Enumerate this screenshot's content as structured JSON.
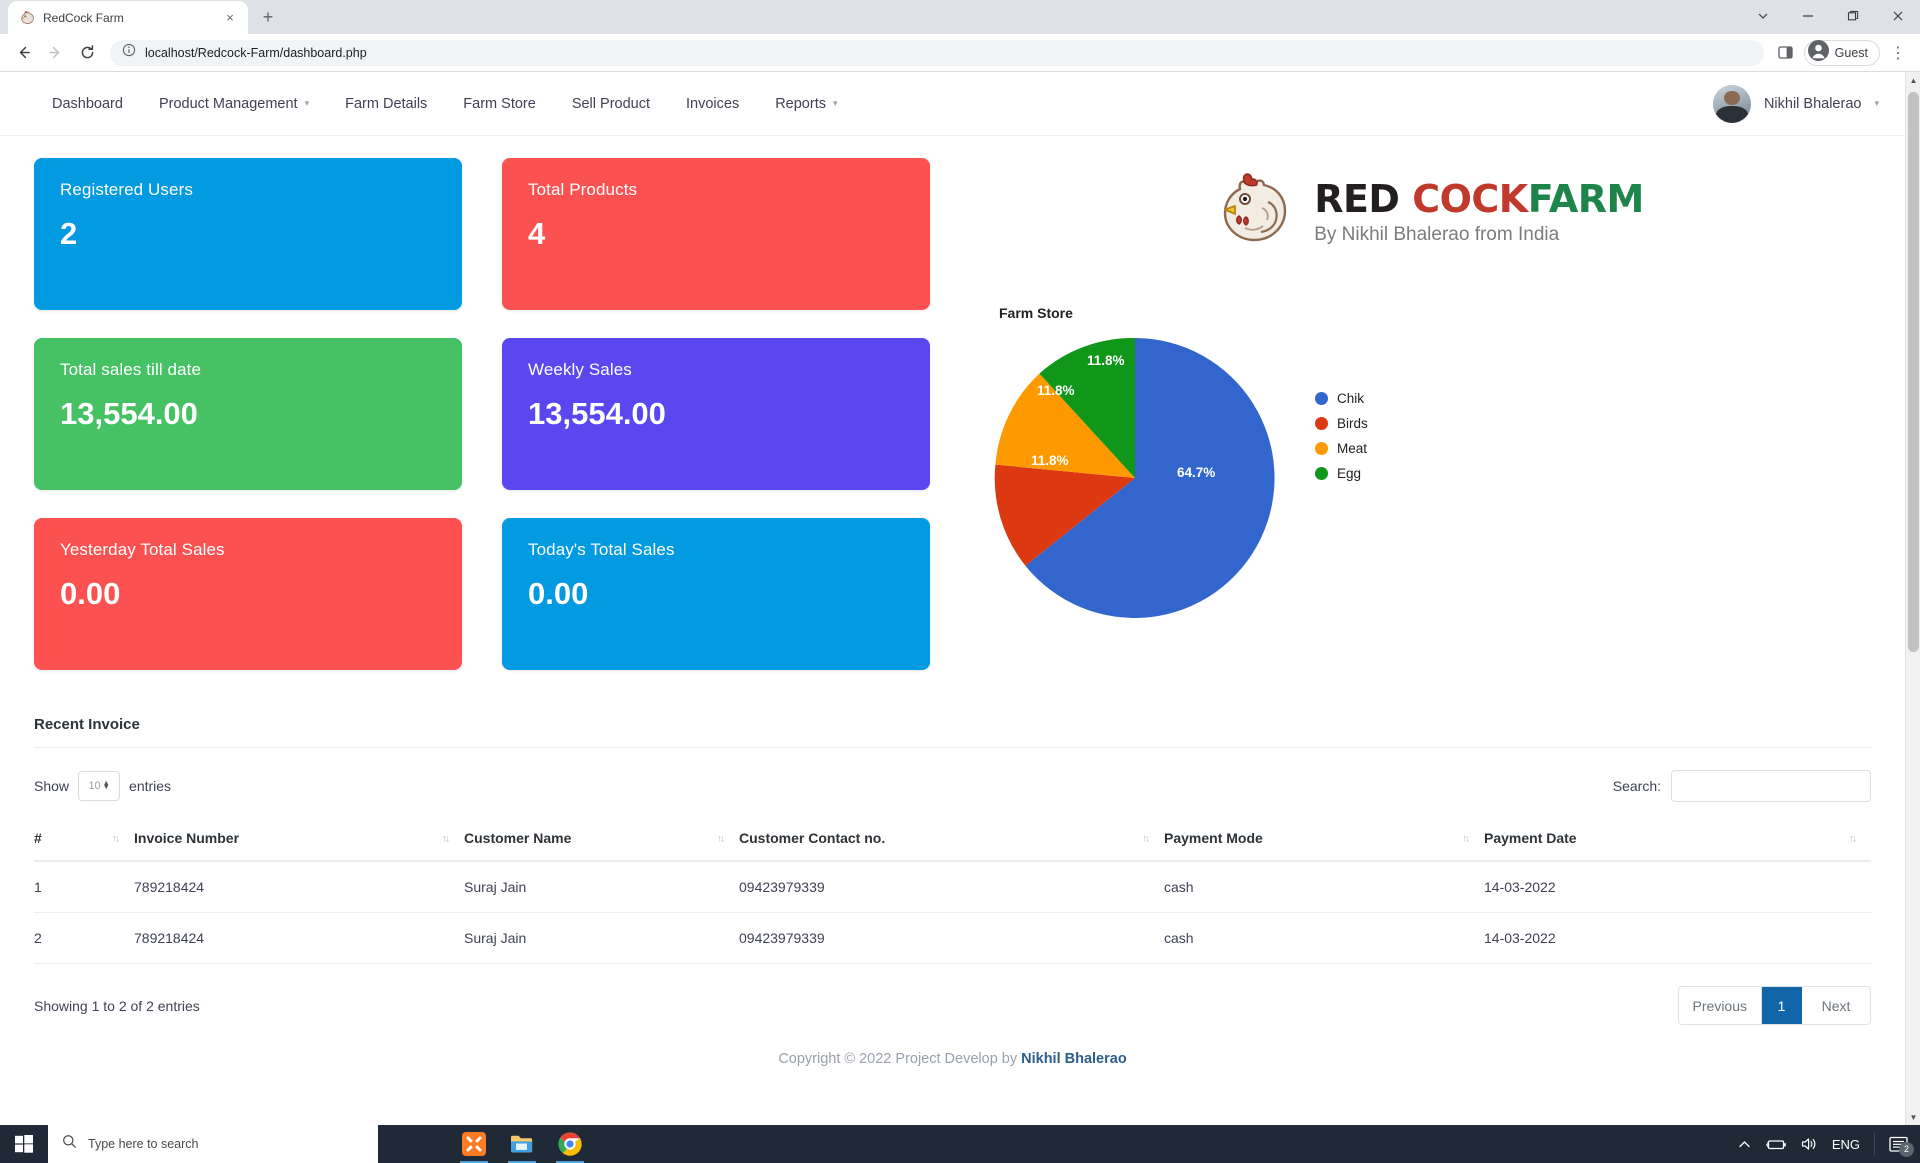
{
  "browser": {
    "tab_title": "RedCock Farm",
    "tab_favicon_name": "rooster-favicon",
    "new_tab_label": "+",
    "close_tab_label": "×",
    "window_controls": {
      "minimize": "—",
      "maximize": "❐",
      "close": "✕",
      "tab_search": "⌄"
    },
    "url": "localhost/Redcock-Farm/dashboard.php",
    "url_prefix": "localhost",
    "profile_label": "Guest",
    "back_label": "←",
    "forward_label": "→",
    "reload_label": "↻",
    "menu_label": "⋮"
  },
  "navbar": {
    "links": [
      {
        "label": "Dashboard",
        "caret": false
      },
      {
        "label": "Product Management",
        "caret": true
      },
      {
        "label": "Farm Details",
        "caret": false
      },
      {
        "label": "Farm Store",
        "caret": false
      },
      {
        "label": "Sell Product",
        "caret": false
      },
      {
        "label": "Invoices",
        "caret": false
      },
      {
        "label": "Reports",
        "caret": true
      }
    ],
    "username": "Nikhil Bhalerao",
    "user_caret": "⌄"
  },
  "stats": [
    {
      "title": "Registered Users",
      "value": "2",
      "color": "#029ae0"
    },
    {
      "title": "Total Products",
      "value": "4",
      "color": "#fb5151"
    },
    {
      "title": "Total sales till date",
      "value": "13,554.00",
      "color": "#46c163"
    },
    {
      "title": "Weekly Sales",
      "value": "13,554.00",
      "color": "#5b47f0"
    },
    {
      "title": "Yesterday Total Sales",
      "value": "0.00",
      "color": "#fb5151"
    },
    {
      "title": "Today's Total Sales",
      "value": "0.00",
      "color": "#029ae0"
    }
  ],
  "logo": {
    "word1": "RED",
    "word2": "COCK",
    "word3": "FARM",
    "tagline": "By Nikhil Bhalerao from India",
    "icon_name": "rooster-logo-icon",
    "color1": "#231f20",
    "color2": "#c0392b",
    "color3": "#1e8449"
  },
  "chart_data": {
    "type": "pie",
    "title": "Farm Store",
    "categories": [
      "Chik",
      "Birds",
      "Meat",
      "Egg"
    ],
    "values": [
      64.7,
      11.8,
      11.8,
      11.8
    ],
    "labels": [
      "64.7%",
      "11.8%",
      "11.8%",
      "11.8%"
    ],
    "colors": [
      "#3366cc",
      "#dc3912",
      "#ff9900",
      "#109618"
    ],
    "legend": {
      "position": "right",
      "entries": [
        {
          "label": "Chik",
          "color": "#3366cc",
          "value": 64.7,
          "display": "64.7%"
        },
        {
          "label": "Birds",
          "color": "#dc3912",
          "value": 11.8,
          "display": "11.8%"
        },
        {
          "label": "Meat",
          "color": "#ff9900",
          "value": 11.8,
          "display": "11.8%"
        },
        {
          "label": "Egg",
          "color": "#109618",
          "value": 11.8,
          "display": "11.8%"
        }
      ]
    },
    "xlabel": "",
    "ylabel": "",
    "grid": false
  },
  "table_panel": {
    "title": "Recent Invoice",
    "show_label": "Show",
    "entries_label": "entries",
    "entries_value": "10",
    "search_label": "Search:",
    "search_value": "",
    "search_placeholder": "",
    "columns": [
      "#",
      "Invoice Number",
      "Customer Name",
      "Customer Contact no.",
      "Payment Mode",
      "Payment Date"
    ],
    "rows": [
      {
        "num": "1",
        "invoice": "789218424",
        "customer": "Suraj Jain",
        "contact": "09423979339",
        "mode": "cash",
        "date": "14-03-2022"
      },
      {
        "num": "2",
        "invoice": "789218424",
        "customer": "Suraj Jain",
        "contact": "09423979339",
        "mode": "cash",
        "date": "14-03-2022"
      }
    ],
    "info": "Showing 1 to 2 of 2 entries",
    "pagination": {
      "previous": "Previous",
      "pages": [
        "1"
      ],
      "next": "Next",
      "active": "1",
      "active_color": "#1266a8"
    }
  },
  "footer": {
    "copyright_prefix": "Copyright © 2022 Project Develop by ",
    "author": "Nikhil Bhalerao"
  },
  "taskbar": {
    "search_placeholder": "Type here to search",
    "start_name": "windows-start-icon",
    "apps": [
      {
        "name": "xampp-icon"
      },
      {
        "name": "file-explorer-icon"
      },
      {
        "name": "chrome-icon"
      }
    ],
    "language": "ENG",
    "notification_count": "2"
  }
}
